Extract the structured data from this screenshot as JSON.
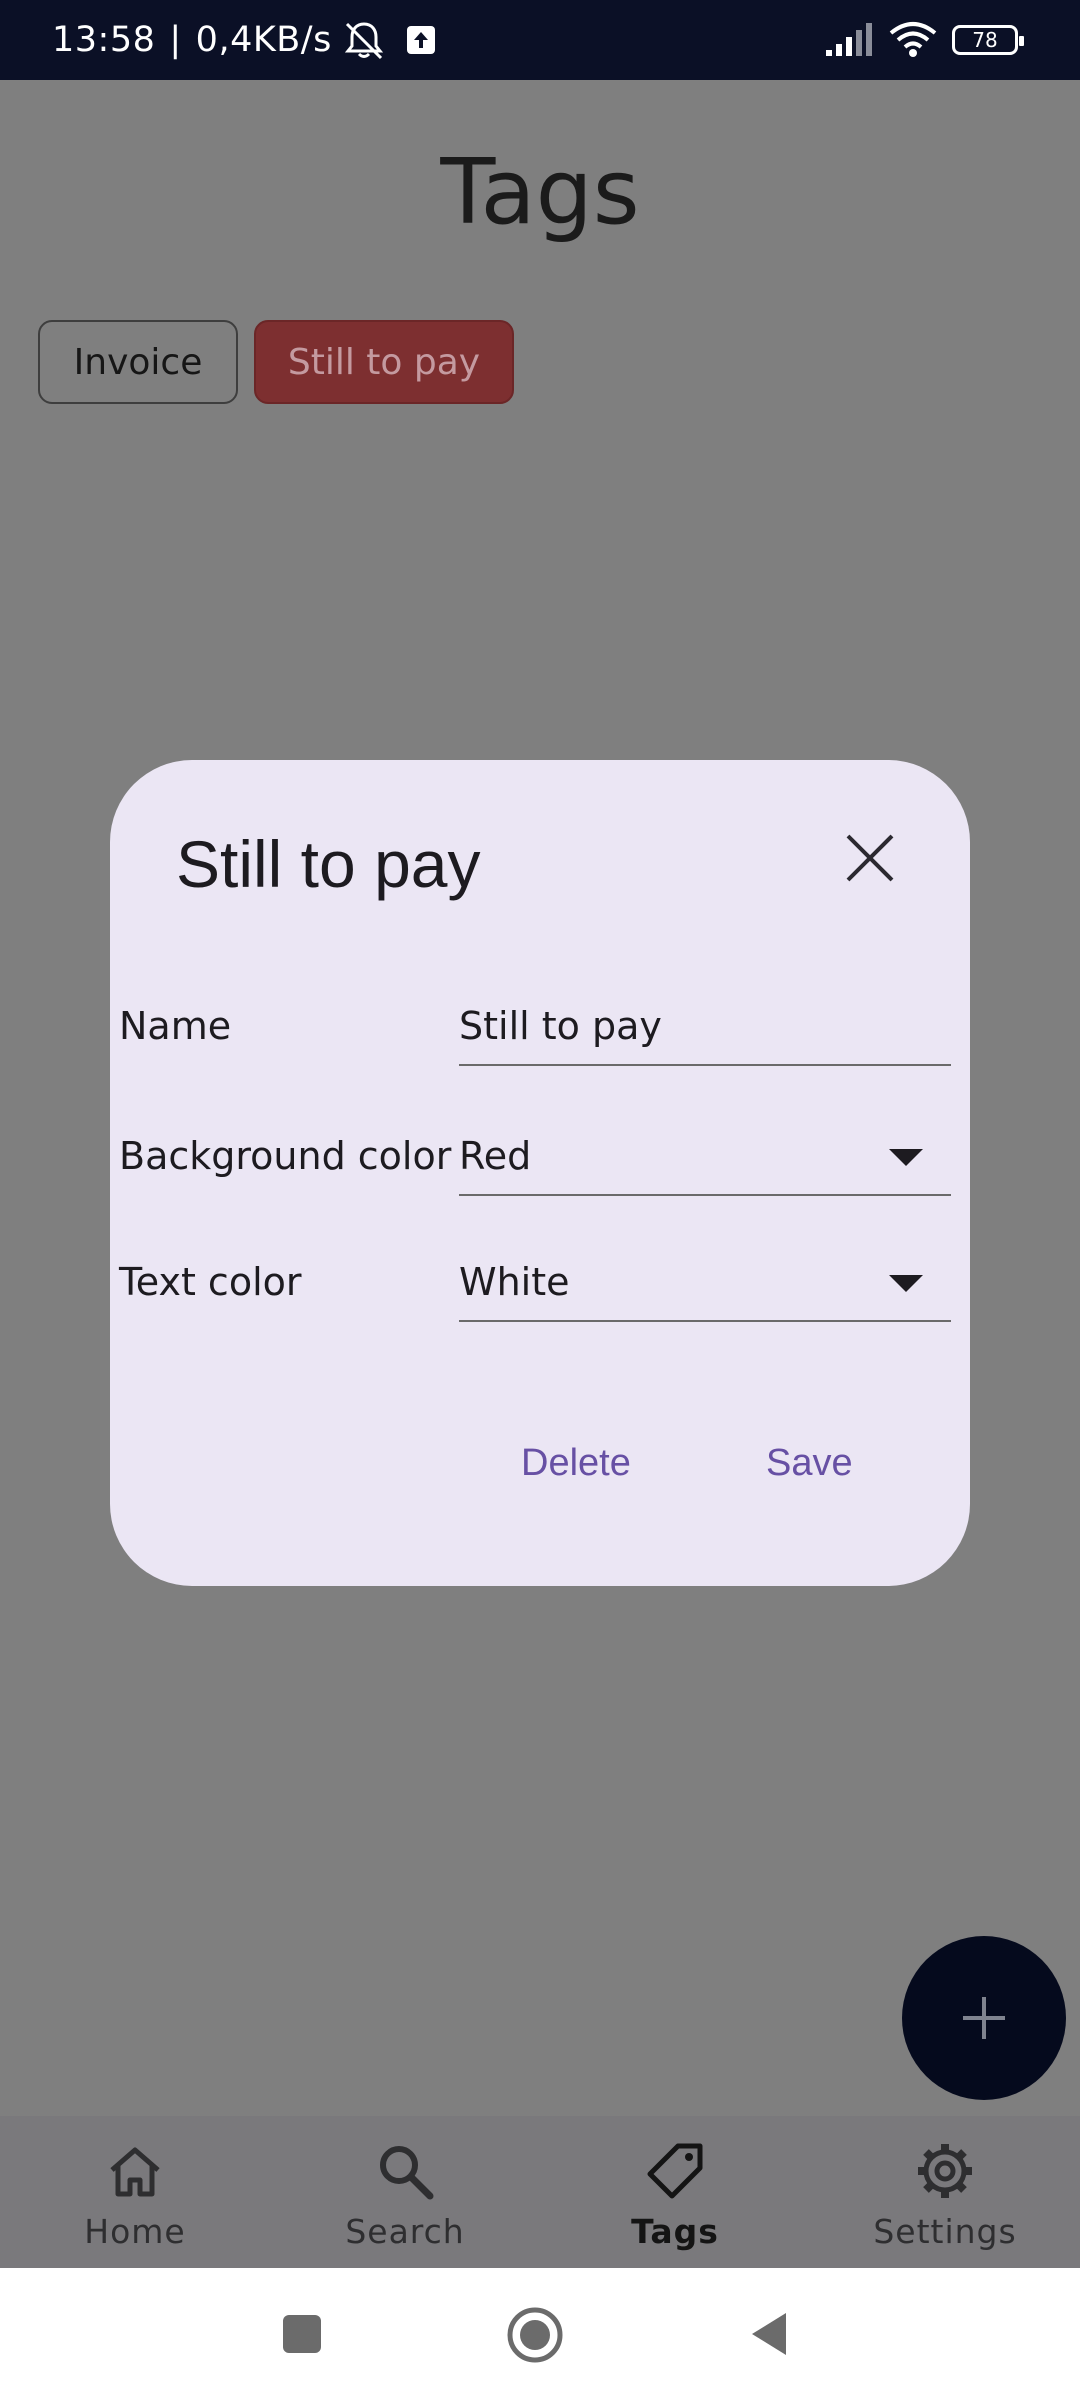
{
  "status_bar": {
    "time": "13:58",
    "separator": "|",
    "network_speed": "0,4KB/s",
    "battery": "78",
    "icons": [
      "bell-muted-icon",
      "upload-icon",
      "signal-icon",
      "wifi-icon",
      "battery-icon"
    ]
  },
  "page": {
    "title": "Tags"
  },
  "tags": [
    {
      "label": "Invoice",
      "background": "transparent",
      "text_color": "#161616"
    },
    {
      "label": "Still to pay",
      "background": "#7d2f30",
      "text_color": "#c49aa0"
    }
  ],
  "dialog": {
    "title": "Still to pay",
    "name_label": "Name",
    "name_value": "Still to pay",
    "background_label": "Background color",
    "background_value": "Red",
    "text_color_label": "Text color",
    "text_color_value": "White",
    "delete_label": "Delete",
    "save_label": "Save",
    "accent_color": "#6750a4",
    "surface_color": "#ebe6f4"
  },
  "fab": {
    "icon": "plus-icon"
  },
  "bottom_nav": {
    "items": [
      {
        "label": "Home",
        "icon": "home-icon",
        "active": false
      },
      {
        "label": "Search",
        "icon": "search-icon",
        "active": false
      },
      {
        "label": "Tags",
        "icon": "tag-icon",
        "active": true
      },
      {
        "label": "Settings",
        "icon": "gear-icon",
        "active": false
      }
    ]
  },
  "system_nav": {
    "icons": [
      "recents-square-icon",
      "home-circle-icon",
      "back-triangle-icon"
    ]
  }
}
